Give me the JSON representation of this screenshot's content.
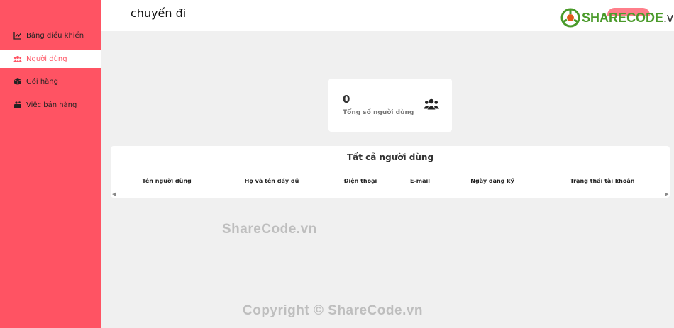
{
  "sidebar": {
    "items": [
      {
        "label": "Bảng điều khiển",
        "icon": "chart-line-icon",
        "active": false
      },
      {
        "label": "Người dùng",
        "icon": "users-icon",
        "active": true
      },
      {
        "label": "Gói hàng",
        "icon": "box-icon",
        "active": false
      },
      {
        "label": "Việc bán hàng",
        "icon": "sales-icon",
        "active": false
      }
    ]
  },
  "header": {
    "title": "chuyến đi"
  },
  "logo": {
    "brand": "SHARECODE",
    "suffix": ".vn"
  },
  "stats": {
    "total_users_value": "0",
    "total_users_label": "Tổng số người dùng"
  },
  "users_table": {
    "title": "Tất cả người dùng",
    "columns": [
      "Tên người dùng",
      "Họ và tên đầy đủ",
      "Điện thoại",
      "E-mail",
      "Ngày đăng ký",
      "Trạng thái tài khoản"
    ],
    "rows": []
  },
  "watermarks": {
    "center": "ShareCode.vn",
    "bottom": "Copyright © ShareCode.vn"
  },
  "colors": {
    "accent": "#ff5363",
    "background": "#f0f0f0",
    "logo_green": "#4a9a2a"
  }
}
